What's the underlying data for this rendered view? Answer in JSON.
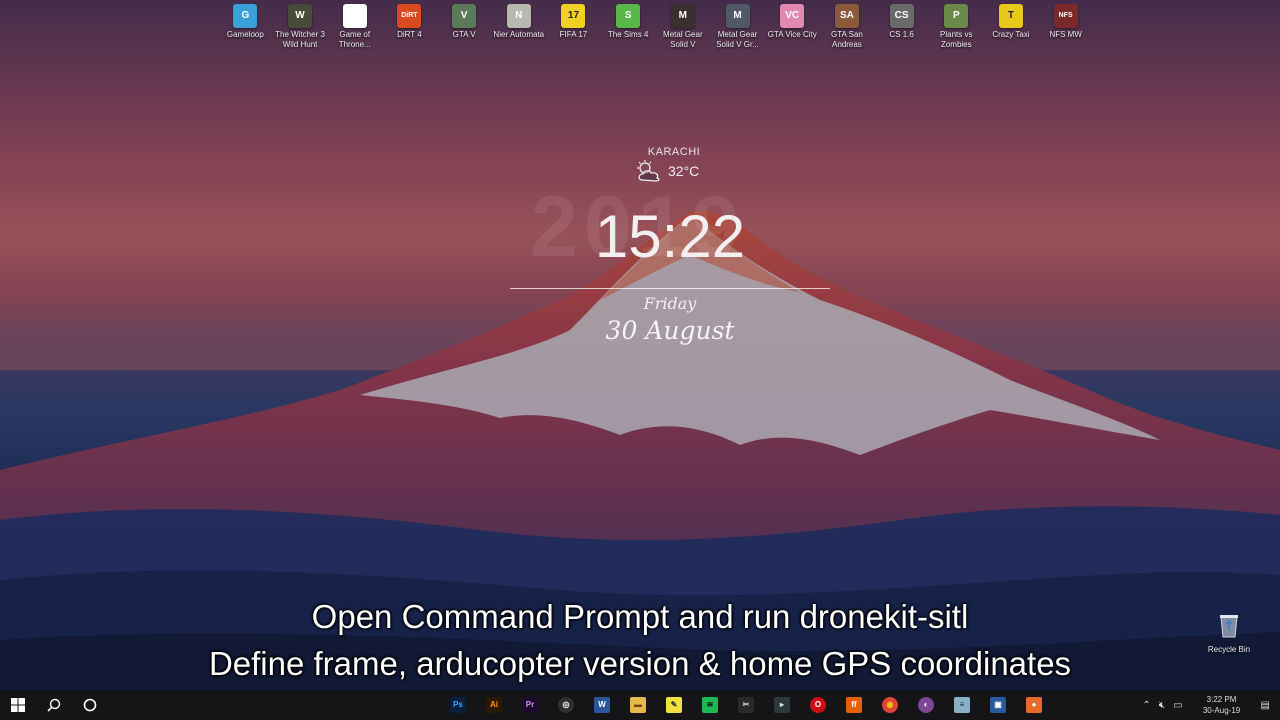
{
  "desktop_icons": [
    {
      "label": "Gameloop",
      "icon": "gameloop-icon",
      "color": "#3aa0d8",
      "glyph": "G"
    },
    {
      "label": "The Witcher 3 Wild Hunt",
      "icon": "witcher-icon",
      "color": "#4a4a3a",
      "glyph": "W"
    },
    {
      "label": "Game of Throne...",
      "icon": "game-of-thrones-icon",
      "color": "#ffffff",
      "glyph": ""
    },
    {
      "label": "DiRT 4",
      "icon": "dirt4-icon",
      "color": "#d94a1e",
      "glyph": "DiRT"
    },
    {
      "label": "GTA V",
      "icon": "gta-v-icon",
      "color": "#5a7a5a",
      "glyph": "V"
    },
    {
      "label": "Nier Automata",
      "icon": "nier-icon",
      "color": "#b8b8b0",
      "glyph": "N"
    },
    {
      "label": "FIFA 17",
      "icon": "fifa17-icon",
      "color": "#f0d020",
      "glyph": "17"
    },
    {
      "label": "The Sims 4",
      "icon": "sims4-icon",
      "color": "#5ab84a",
      "glyph": "S"
    },
    {
      "label": "Metal Gear Solid V",
      "icon": "mgsv-icon",
      "color": "#3a3030",
      "glyph": "M"
    },
    {
      "label": "Metal Gear Solid V Gr...",
      "icon": "mgsv-gz-icon",
      "color": "#505a66",
      "glyph": "M"
    },
    {
      "label": "GTA Vice City",
      "icon": "gta-vice-city-icon",
      "color": "#e08ab0",
      "glyph": "VC"
    },
    {
      "label": "GTA San Andreas",
      "icon": "gta-san-andreas-icon",
      "color": "#8a5a3a",
      "glyph": "SA"
    },
    {
      "label": "CS 1.6",
      "icon": "counter-strike-icon",
      "color": "#6a6a6a",
      "glyph": "CS"
    },
    {
      "label": "Plants vs Zombies",
      "icon": "plants-vs-zombies-icon",
      "color": "#6a8a4a",
      "glyph": "P"
    },
    {
      "label": "Crazy Taxi",
      "icon": "crazy-taxi-icon",
      "color": "#e8c81a",
      "glyph": "T"
    },
    {
      "label": "NFS MW",
      "icon": "nfs-mw-icon",
      "color": "#7a2a2a",
      "glyph": "NFS"
    }
  ],
  "widget": {
    "city": "KARACHI",
    "temperature": "32°C",
    "weather_icon": "partly-cloudy-icon",
    "ghost_year": "2019",
    "time": "15:22",
    "day": "Friday",
    "date": "30 August"
  },
  "recycle_bin": {
    "label": "Recycle Bin",
    "icon": "recycle-bin-icon"
  },
  "subtitles": {
    "line1": "Open Command Prompt and run dronekit-sitl",
    "line2": "Define frame, arducopter version & home GPS coordinates"
  },
  "taskbar": {
    "apps": [
      {
        "name": "photoshop",
        "glyph": "Ps",
        "bg": "#0a1f3a",
        "fg": "#31a8ff"
      },
      {
        "name": "illustrator",
        "glyph": "Ai",
        "bg": "#2b1a00",
        "fg": "#ff9a00"
      },
      {
        "name": "premiere",
        "glyph": "Pr",
        "bg": "#1e0a2e",
        "fg": "#d291ff"
      },
      {
        "name": "obs",
        "glyph": "◎",
        "bg": "#303030",
        "fg": "#ffffff"
      },
      {
        "name": "word",
        "glyph": "W",
        "bg": "#2b579a",
        "fg": "#ffffff"
      },
      {
        "name": "file-explorer",
        "glyph": "▬",
        "bg": "#e8b84a",
        "fg": "#6a4a10"
      },
      {
        "name": "sticky-notes",
        "glyph": "✎",
        "bg": "#f0e040",
        "fg": "#333333"
      },
      {
        "name": "spotify",
        "glyph": "≋",
        "bg": "#1db954",
        "fg": "#111111"
      },
      {
        "name": "snipping",
        "glyph": "✂",
        "bg": "#2a2a2a",
        "fg": "#dddddd"
      },
      {
        "name": "media",
        "glyph": "▸",
        "bg": "#2a3a3a",
        "fg": "#dddddd"
      },
      {
        "name": "opera",
        "glyph": "O",
        "bg": "#cc0f16",
        "fg": "#ffffff"
      },
      {
        "name": "firefox",
        "glyph": "ff",
        "bg": "#e66000",
        "fg": "#ffffff"
      },
      {
        "name": "chrome",
        "glyph": "◉",
        "bg": "#db4437",
        "fg": "#f4c20d"
      },
      {
        "name": "tor",
        "glyph": "◐",
        "bg": "#7d4698",
        "fg": "#ffffff"
      },
      {
        "name": "notepad",
        "glyph": "≡",
        "bg": "#8ab0c8",
        "fg": "#1a2a3a"
      },
      {
        "name": "store",
        "glyph": "▣",
        "bg": "#2a5a9a",
        "fg": "#ffffff"
      },
      {
        "name": "recorder",
        "glyph": "●",
        "bg": "#e86a2a",
        "fg": "#ffffff"
      }
    ],
    "clock_time": "3:22 PM",
    "clock_date": "30-Aug-19"
  },
  "colors": {
    "accent": "#f3eef0",
    "taskbar": "#151417"
  }
}
